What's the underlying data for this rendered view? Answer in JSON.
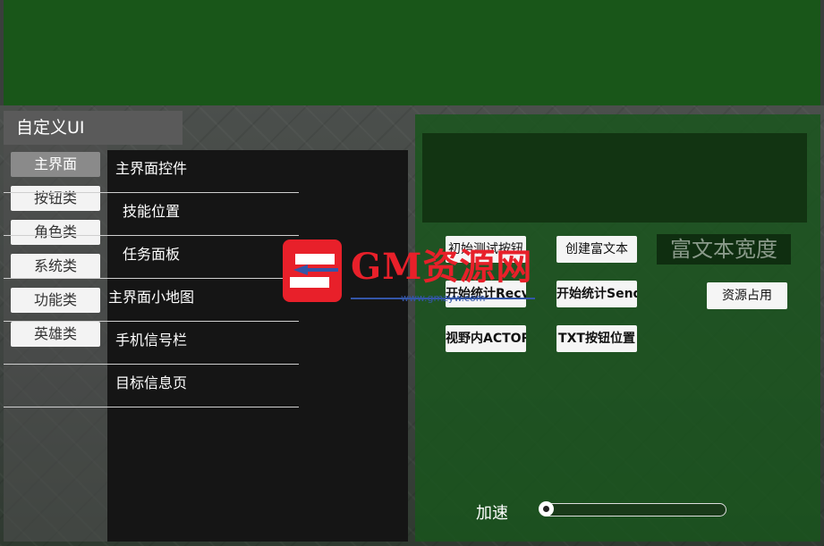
{
  "window": {
    "title": "自定义UI"
  },
  "categories": [
    {
      "label": "主界面",
      "active": true
    },
    {
      "label": "按钮类"
    },
    {
      "label": "角色类"
    },
    {
      "label": "系统类"
    },
    {
      "label": "功能类"
    },
    {
      "label": "英雄类"
    }
  ],
  "sub_items": [
    {
      "label": "主界面控件"
    },
    {
      "label": "技能位置"
    },
    {
      "label": "任务面板"
    },
    {
      "label": "主界面小地图"
    },
    {
      "label": "手机信号栏"
    },
    {
      "label": "目标信息页"
    }
  ],
  "actions": {
    "row1": [
      "初始测试按钮",
      "创建富文本"
    ],
    "row2": [
      "开始统计Recv",
      "开始统计Send",
      "资源占用"
    ],
    "row3": [
      "视野内ACTOR",
      "TXT按钮位置"
    ]
  },
  "rich_text_width": "富文本宽度",
  "speed": {
    "label": "加速",
    "value": 0.0
  },
  "watermark": {
    "brand": "GM资源网",
    "url": "www.gmzyw.com"
  },
  "colors": {
    "top_bar": "#195619",
    "panel_green": "#1a5a1c",
    "accent_red": "#e8202a"
  }
}
